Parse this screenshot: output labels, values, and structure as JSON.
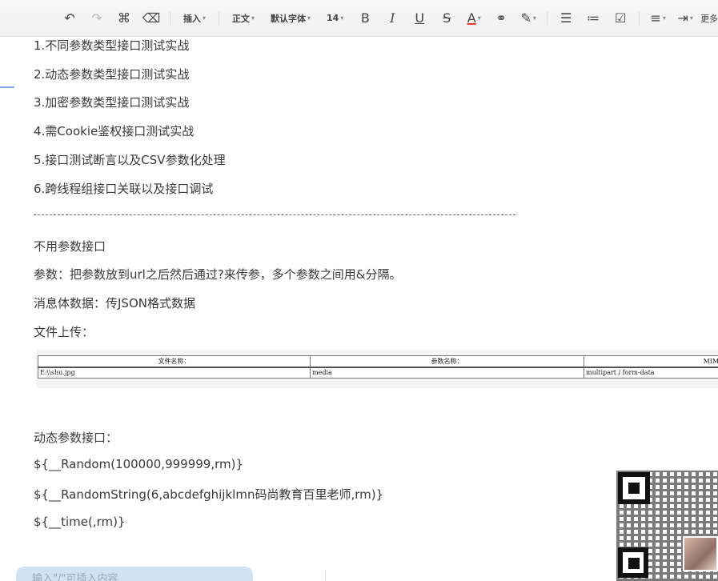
{
  "toolbar": {
    "insert": "插入",
    "para_style": "正文",
    "font_family": "默认字体",
    "font_size": "14",
    "bold": "B",
    "italic": "I",
    "underline": "U",
    "strike": "S",
    "font_color": "A",
    "more": "更多"
  },
  "document": {
    "list": [
      "1.不同参数类型接口测试实战",
      "2.动态参数类型接口测试实战",
      "3.加密参数类型接口测试实战",
      "4.需Cookie鉴权接口测试实战",
      "5.接口测试断言以及CSV参数化处理",
      "6.跨线程组接口关联以及接口调试"
    ],
    "section1_title": "不用参数接口",
    "params_note": "参数：把参数放到url之后然后通过?来传参，多个参数之间用&分隔。",
    "body_note": "消息体数据：传JSON格式数据",
    "upload_title": "文件上传：",
    "section2_title": "动态参数接口：",
    "func_random": "${__Random(100000,999999,rm)}",
    "func_random_string": "${__RandomString(6,abcdefghijklmn码尚教育百里老师,rm)}",
    "func_time": "${__time(,rm)}"
  },
  "upload_table": {
    "headers": [
      "文件名称：",
      "参数名称：",
      "MIME"
    ],
    "row": [
      "E:\\\\shu.jpg",
      "media",
      "multipart / form-data"
    ]
  },
  "bottom": {
    "input_placeholder": "输入\"/\"可插入内容"
  }
}
